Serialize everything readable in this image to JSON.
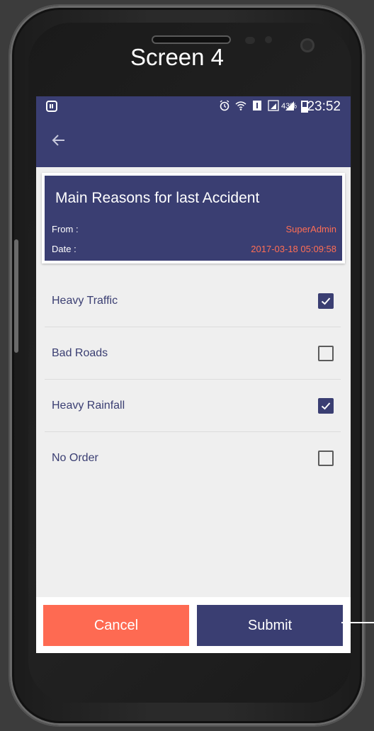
{
  "caption": "Screen 4",
  "status_bar": {
    "battery_percent": "43%",
    "time": "23:52"
  },
  "card": {
    "title": "Main Reasons for last Accident",
    "from_label": "From :",
    "from_value": "SuperAdmin",
    "date_label": "Date :",
    "date_value": "2017-03-18 05:09:58"
  },
  "options": [
    {
      "label": "Heavy Traffic",
      "checked": true
    },
    {
      "label": "Bad Roads",
      "checked": false
    },
    {
      "label": "Heavy Rainfall",
      "checked": true
    },
    {
      "label": "No Order",
      "checked": false
    }
  ],
  "buttons": {
    "cancel_label": "Cancel",
    "submit_label": "Submit"
  },
  "colors": {
    "primary": "#3a3e72",
    "accent": "#fe6a52",
    "value_text": "#ff6e54",
    "background": "#efefef"
  },
  "icons": {
    "back": "arrow-left-icon",
    "alarm": "alarm-icon",
    "wifi": "wifi-icon",
    "sim": "sim-icon",
    "signal": "signal-icon",
    "battery": "battery-icon",
    "check": "check-icon"
  }
}
